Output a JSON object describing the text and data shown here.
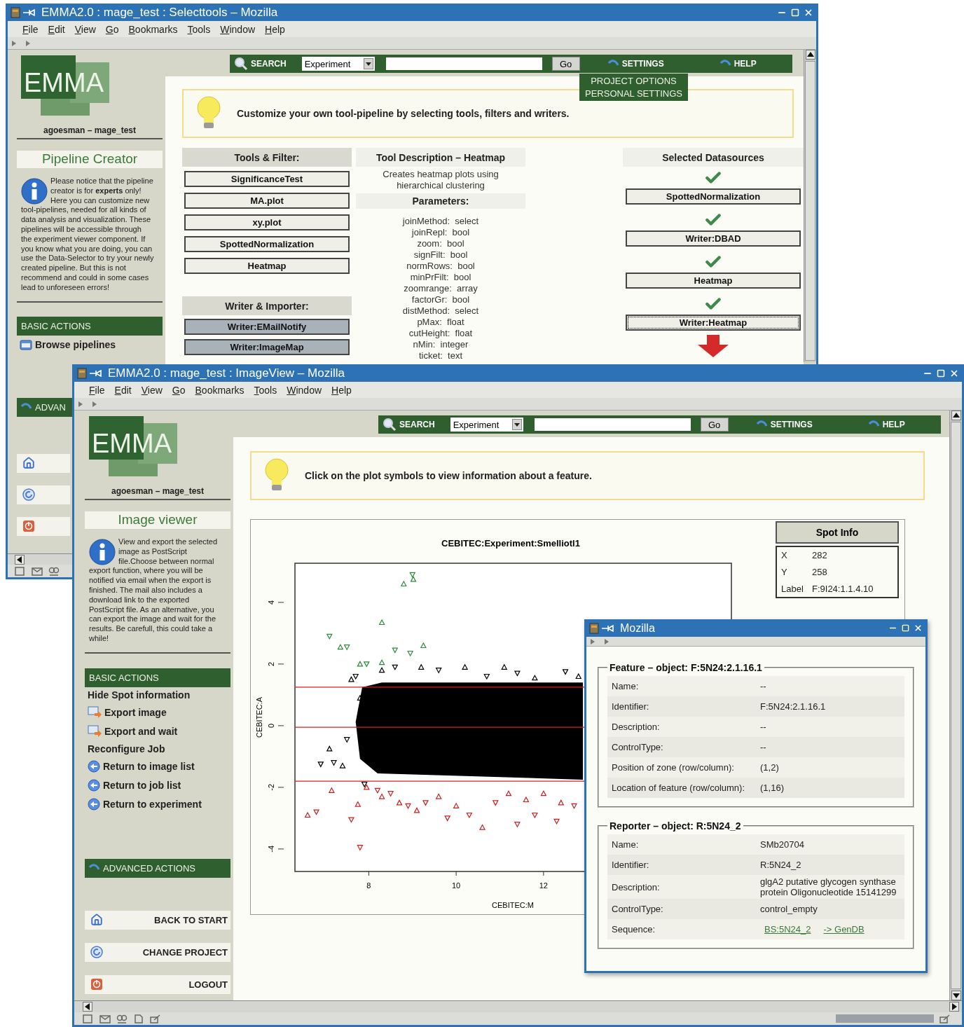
{
  "back_window": {
    "title": "EMMA2.0 : mage_test : Selecttools – Mozilla",
    "menu": [
      "File",
      "Edit",
      "View",
      "Go",
      "Bookmarks",
      "Tools",
      "Window",
      "Help"
    ],
    "logo": "EMMA",
    "user": "agoesman – mage_test",
    "page_title": "Pipeline Creator",
    "info": "Please notice that the pipeline creator is for **experts** only! Here you can customize new tool-pipelines, needed for all kinds of data analysis and visualization. These pipelines will be accessible through the experiment viewer component. If you know what you are doing, you can use the Data-Selector to try your newly created pipeline. But this is not recommend and could in some cases lead to unforeseen errors!",
    "basic_actions": {
      "title": "BASIC ACTIONS",
      "items": [
        {
          "label": "Browse pipelines",
          "kind": "folder"
        }
      ]
    },
    "advanced_actions": {
      "title": "ADVAN"
    },
    "toolbar": {
      "search": "SEARCH",
      "scope": "Experiment",
      "go": "Go",
      "settings": "SETTINGS",
      "help": "HELP"
    },
    "settings_menu": [
      "PROJECT OPTIONS",
      "PERSONAL SETTINGS"
    ],
    "hint": "Customize your own tool-pipeline by selecting tools, filters and writers.",
    "tools": {
      "title": "Tools & Filter:",
      "items": [
        "SignificanceTest",
        "MA.plot",
        "xy.plot",
        "SpottedNormalization",
        "Heatmap"
      ]
    },
    "writers": {
      "title": "Writer & Importer:",
      "items": [
        "Writer:EMailNotify",
        "Writer:ImageMap"
      ]
    },
    "description": {
      "title": "Tool Description – Heatmap",
      "text": "Creates heatmap plots using hierarchical clustering",
      "parameters_title": "Parameters:",
      "parameters": [
        "joinMethod:  select",
        "joinRepl:  bool",
        "zoom:  bool",
        "signFilt:  bool",
        "normRows:  bool",
        "minPrFilt:  bool",
        "zoomrange:  array",
        "factorGr:  bool",
        "distMethod:  select",
        "pMax:  float",
        "cutHeight:  float",
        "nMin:  integer",
        "ticket:  text"
      ]
    },
    "datasources": {
      "title": "Selected Datasources",
      "items": [
        {
          "label": "SpottedNormalization",
          "focused": false
        },
        {
          "label": "Writer:DBAD",
          "focused": false
        },
        {
          "label": "Heatmap",
          "focused": false
        },
        {
          "label": "Writer:Heatmap",
          "focused": true
        }
      ]
    }
  },
  "front_window": {
    "title": "EMMA2.0 : mage_test : ImageView – Mozilla",
    "menu": [
      "File",
      "Edit",
      "View",
      "Go",
      "Bookmarks",
      "Tools",
      "Window",
      "Help"
    ],
    "logo": "EMMA",
    "user": "agoesman – mage_test",
    "page_title": "Image viewer",
    "info": "View and export the selected image as PostScript file.Choose between normal export function, where you will be notified via email when the export is finished. The mail also includes a download link to the exported PostScript file. As an alternative, you can export the image and wait for the results. Be carefull, this could take a while!",
    "basic_actions": {
      "title": "BASIC ACTIONS",
      "items": [
        {
          "label": "Hide Spot information",
          "kind": "plain"
        },
        {
          "label": "Export image",
          "kind": "export"
        },
        {
          "label": "Export and wait",
          "kind": "export"
        },
        {
          "label": "Reconfigure Job",
          "kind": "plain"
        },
        {
          "label": "Return to image list",
          "kind": "back"
        },
        {
          "label": "Return to job list",
          "kind": "back"
        },
        {
          "label": "Return to experiment",
          "kind": "back"
        }
      ]
    },
    "advanced_actions": {
      "title": "ADVANCED ACTIONS"
    },
    "nav": [
      {
        "label": "BACK TO START",
        "kind": "home"
      },
      {
        "label": "CHANGE PROJECT",
        "kind": "change"
      },
      {
        "label": "LOGOUT",
        "kind": "logout"
      }
    ],
    "toolbar": {
      "search": "SEARCH",
      "scope": "Experiment",
      "go": "Go",
      "settings": "SETTINGS",
      "help": "HELP"
    },
    "hint": "Click on the plot symbols to view information about a feature.",
    "chart_data": {
      "type": "scatter",
      "title": "CEBITEC:Experiment:Smelliotl1",
      "xlabel": "CEBITEC:M",
      "ylabel": "CEBITEC:A",
      "xlim": [
        6.31,
        16.3
      ],
      "ylim": [
        -4.73,
        5.27
      ],
      "xticks": [
        8,
        10,
        12
      ],
      "yticks": [
        -4,
        -2,
        0,
        2,
        4
      ],
      "series": [
        {
          "color": "#2e8b3a",
          "x": [
            8.8,
            9.0,
            9.02,
            7.1,
            7.35,
            7.5,
            8.3,
            8.6,
            9.25,
            8.95,
            7.8,
            7.95,
            8.3
          ],
          "values": [
            4.6,
            4.9,
            4.75,
            2.9,
            2.55,
            2.55,
            3.35,
            2.45,
            2.6,
            2.35,
            2.0,
            2.0,
            2.05
          ]
        },
        {
          "color": "#000000",
          "x": [
            6.9,
            7.1,
            7.2,
            7.4,
            7.5,
            7.6,
            7.7,
            7.8,
            7.9,
            8.3,
            8.6,
            9.2,
            9.6,
            10.2,
            10.7,
            11.1,
            11.4,
            11.8,
            12.5,
            12.8
          ],
          "values": [
            -1.25,
            -0.75,
            -1.2,
            -1.3,
            -0.45,
            1.5,
            1.6,
            0.9,
            -1.9,
            1.8,
            1.9,
            1.9,
            1.8,
            1.9,
            1.6,
            1.9,
            1.7,
            1.55,
            1.75,
            1.6
          ]
        },
        {
          "color": "#cc2020",
          "x": [
            6.6,
            6.8,
            7.15,
            7.6,
            7.75,
            7.8,
            7.95,
            8.2,
            8.3,
            8.5,
            8.7,
            8.9,
            9.1,
            9.3,
            9.6,
            9.8,
            10.0,
            10.3,
            10.6,
            10.9,
            11.2,
            11.4,
            11.6,
            11.8,
            12.0,
            12.3,
            12.4,
            12.7
          ],
          "values": [
            -2.9,
            -2.8,
            -2.1,
            -3.05,
            -2.55,
            -3.95,
            -2.0,
            -2.1,
            -2.3,
            -2.2,
            -2.5,
            -2.6,
            -2.75,
            -2.5,
            -2.3,
            -3.0,
            -2.6,
            -2.9,
            -3.3,
            -2.5,
            -2.2,
            -3.2,
            -2.4,
            -2.9,
            -2.2,
            -3.1,
            -2.5,
            -2.6
          ]
        }
      ],
      "bands": [
        {
          "axis": "y",
          "from": -1.75,
          "to": 1.4
        }
      ],
      "ref_lines": [
        {
          "axis": "y",
          "value": 1.25
        },
        {
          "axis": "y",
          "value": -0.05
        },
        {
          "axis": "y",
          "value": -1.8
        }
      ]
    },
    "spot_info": {
      "title": "Spot Info",
      "rows": [
        {
          "key": "X",
          "value": "282"
        },
        {
          "key": "Y",
          "value": "258"
        },
        {
          "key": "Label",
          "value": "F:9I24:1.1.4.10"
        }
      ]
    }
  },
  "popup_window": {
    "title": "Mozilla",
    "sections": [
      {
        "legend": "Feature – object: F:5N24:2.1.16.1",
        "rows": [
          {
            "key": "Name:",
            "kind": "text",
            "value": "--"
          },
          {
            "key": "Identifier:",
            "kind": "text",
            "value": "F:5N24:2.1.16.1"
          },
          {
            "key": "Description:",
            "kind": "text",
            "value": "--"
          },
          {
            "key": "ControlType:",
            "kind": "text",
            "value": "--"
          },
          {
            "key": "Position of zone (row/column):",
            "kind": "text",
            "value": "(1,2)"
          },
          {
            "key": "Location of feature (row/column):",
            "kind": "text",
            "value": "(1,16)"
          }
        ]
      },
      {
        "legend": "Reporter – object: R:5N24_2",
        "rows": [
          {
            "key": "Name:",
            "kind": "text",
            "value": "SMb20704"
          },
          {
            "key": "Identifier:",
            "kind": "text",
            "value": "R:5N24_2"
          },
          {
            "key": "Description:",
            "kind": "text",
            "value": "glgA2 putative glycogen synthase protein Oligonucleotide 15141299"
          },
          {
            "key": "ControlType:",
            "kind": "text",
            "value": "control_empty"
          },
          {
            "key": "Sequence:",
            "kind": "links",
            "links": [
              "BS:5N24_2",
              "-> GenDB"
            ]
          }
        ]
      }
    ]
  }
}
